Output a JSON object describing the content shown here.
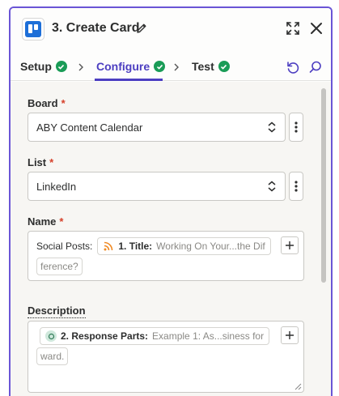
{
  "header": {
    "title": "3. Create Card",
    "app_icon": "trello-icon"
  },
  "tabs": [
    {
      "label": "Setup",
      "complete": true
    },
    {
      "label": "Configure",
      "complete": true,
      "active": true
    },
    {
      "label": "Test",
      "complete": true
    }
  ],
  "fields": {
    "board": {
      "label": "Board",
      "required": "*",
      "value": "ABY Content Calendar"
    },
    "list": {
      "label": "List",
      "required": "*",
      "value": "LinkedIn"
    },
    "name": {
      "label": "Name",
      "required": "*",
      "prefix": "Social Posts:",
      "pill_label": "1. Title:",
      "pill_value": "Working On Your...the Dif",
      "pill_value_cont": "ference?"
    },
    "description": {
      "label": "Description",
      "pill_label": "2. Response Parts:",
      "pill_value": "Example 1:  As...siness for",
      "pill_value_cont": "ward."
    }
  },
  "colors": {
    "accent": "#4c3ec1",
    "border_accent": "#6a55d6",
    "success": "#1a9c57",
    "required": "#d6402a",
    "trello_blue": "#1d6fd8"
  }
}
